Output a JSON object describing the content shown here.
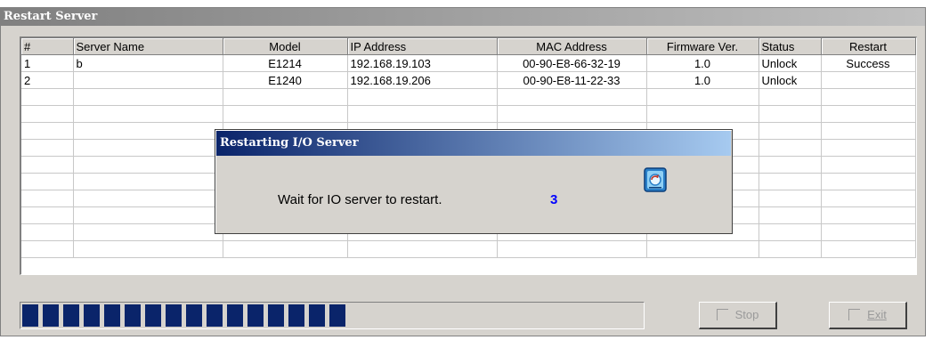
{
  "window": {
    "title": "Restart Server"
  },
  "table": {
    "columns": [
      "#",
      "Server Name",
      "Model",
      "IP Address",
      "MAC Address",
      "Firmware Ver.",
      "Status",
      "Restart"
    ],
    "rows": [
      [
        "1",
        "b",
        "E1214",
        "192.168.19.103",
        "00-90-E8-66-32-19",
        "1.0",
        "Unlock",
        "Success"
      ],
      [
        "2",
        "",
        "E1240",
        "192.168.19.206",
        "00-90-E8-11-22-33",
        "1.0",
        "Unlock",
        ""
      ]
    ],
    "empty_rows": 10
  },
  "dialog": {
    "title": "Restarting I/O Server",
    "message": "Wait for IO server to restart.",
    "countdown": "3",
    "icon": "server-restart-icon"
  },
  "progress": {
    "filled_segments": 16,
    "value": 0.54
  },
  "buttons": {
    "stop_label": "Stop",
    "exit_label": "Exit"
  },
  "colors": {
    "progress_fill": "#0a246a",
    "countdown": "#0000ff",
    "dialog_title_start": "#0a246a"
  }
}
